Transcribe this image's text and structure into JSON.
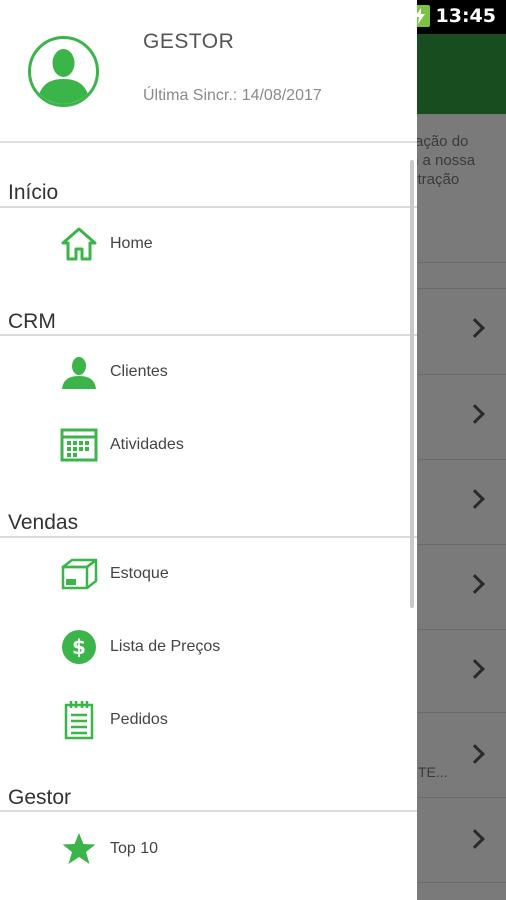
{
  "status_bar": {
    "time": "13:45"
  },
  "background": {
    "text_lines": [
      "ração do",
      "n a nossa",
      "stração"
    ],
    "fragment": "TE..."
  },
  "drawer": {
    "user": {
      "name": "GESTOR",
      "last_sync": "Última Sincr.: 14/08/2017"
    },
    "sections": {
      "inicio": {
        "title": "Início",
        "items": [
          {
            "label": "Home",
            "icon": "home-icon"
          }
        ]
      },
      "crm": {
        "title": "CRM",
        "items": [
          {
            "label": "Clientes",
            "icon": "person-icon"
          },
          {
            "label": "Atividades",
            "icon": "calendar-icon"
          }
        ]
      },
      "vendas": {
        "title": "Vendas",
        "items": [
          {
            "label": "Estoque",
            "icon": "box-icon"
          },
          {
            "label": "Lista de Preços",
            "icon": "dollar-icon"
          },
          {
            "label": "Pedidos",
            "icon": "notepad-icon"
          }
        ]
      },
      "gestor": {
        "title": "Gestor",
        "items": [
          {
            "label": "Top 10",
            "icon": "star-icon"
          }
        ]
      }
    }
  },
  "colors": {
    "accent": "#3bb54a",
    "toolbar": "#174d1f",
    "battery": "#7cc243"
  }
}
